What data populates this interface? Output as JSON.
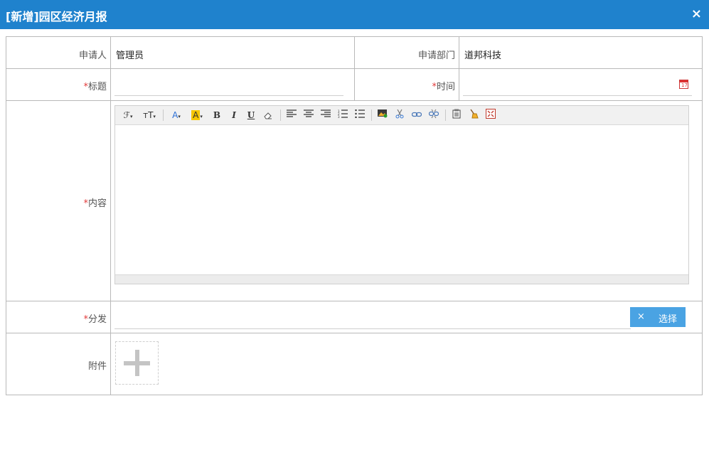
{
  "window": {
    "title": "[新增]园区经济月报",
    "close_glyph": "×"
  },
  "form": {
    "applicant": {
      "label": "申请人",
      "value": "管理员"
    },
    "department": {
      "label": "申请部门",
      "value": "道邦科技"
    },
    "subject": {
      "required_mark": "*",
      "label": "标题",
      "value": ""
    },
    "time": {
      "required_mark": "*",
      "label": "时间",
      "value": ""
    },
    "content": {
      "required_mark": "*",
      "label": "内容"
    },
    "distribute": {
      "required_mark": "*",
      "label": "分发",
      "value": "",
      "clear_glyph": "×",
      "pick_label": "选择"
    },
    "attachment": {
      "label": "附件"
    }
  },
  "editor_toolbar": {
    "font_family": "ℱ",
    "font_size": "ᴛT",
    "font_color": "A",
    "highlight": "A",
    "bold": "B",
    "italic": "I",
    "underline": "U",
    "dropdown": "▾"
  },
  "colors": {
    "titlebar": "#1f82cd",
    "pick_button": "#4aa3e3",
    "required": "#e23b3b",
    "border": "#b9b9b9"
  }
}
